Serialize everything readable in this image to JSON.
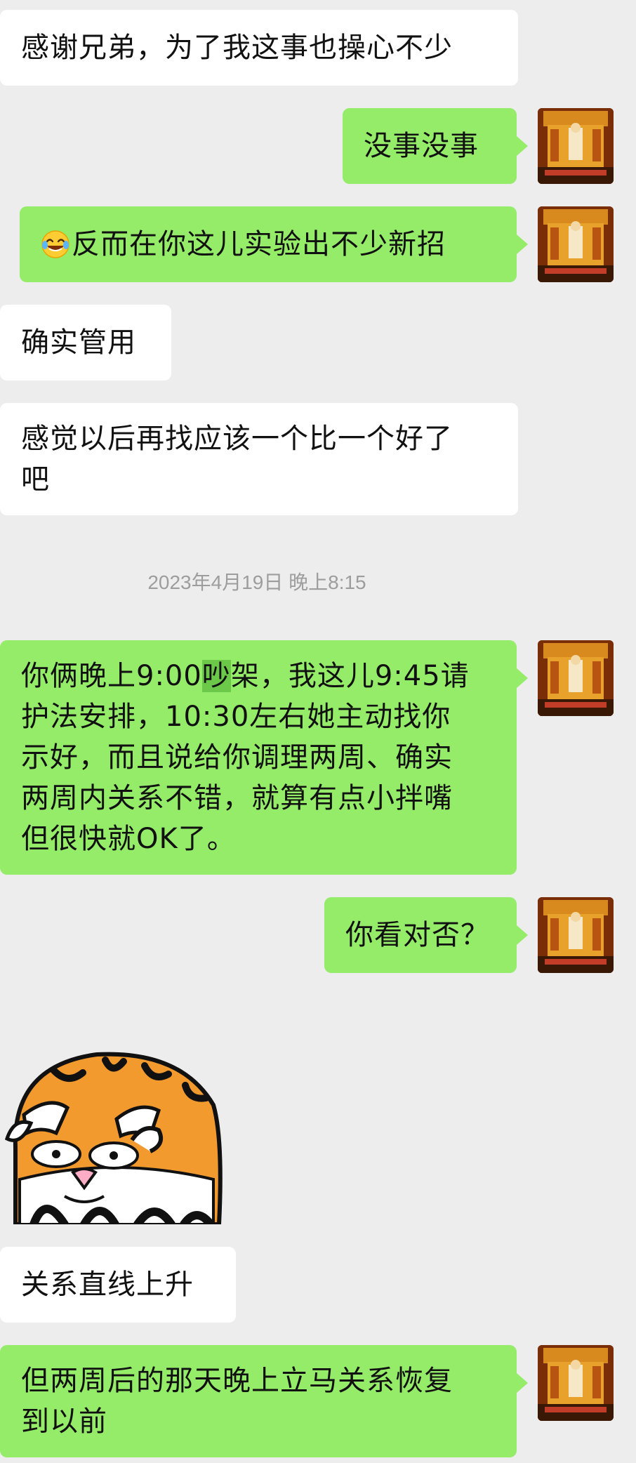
{
  "messages": [
    {
      "id": "m1",
      "side": "left",
      "text": "感谢兄弟，为了我这事也操心不少"
    },
    {
      "id": "m2",
      "side": "right",
      "text": "没事没事"
    },
    {
      "id": "m3",
      "side": "right",
      "emoji": "laughing-with-tears",
      "text": "反而在你这儿实验出不少新招"
    },
    {
      "id": "m4",
      "side": "left",
      "text": "确实管用"
    },
    {
      "id": "m5",
      "side": "left",
      "text": "感觉以后再找应该一个比一个好了\n吧"
    },
    {
      "id": "m6",
      "side": "right",
      "line1_prefix": "你俩晚上9:00",
      "line1_highlight": "吵",
      "line1_suffix": "架，我这儿9:45请",
      "text_rest": "护法安排，10:30左右她主动找你\n示好，而且说给你调理两周、确实\n两周内关系不错，就算有点小拌嘴\n但很快就OK了。"
    },
    {
      "id": "m7",
      "side": "right",
      "text": "你看对否？"
    },
    {
      "id": "m8",
      "side": "left",
      "text": "关系直线上升"
    },
    {
      "id": "m9",
      "side": "right",
      "text": "但两周后的那天晚上立马关系恢复\n到以前"
    }
  ],
  "timestamp": "2023年4月19日 晚上8:15",
  "sticker": {
    "name": "tiger-sticker"
  },
  "colors": {
    "background": "#ededed",
    "right_bubble": "#95ec69",
    "left_bubble": "#ffffff",
    "timestamp_text": "#9d9d9d"
  }
}
